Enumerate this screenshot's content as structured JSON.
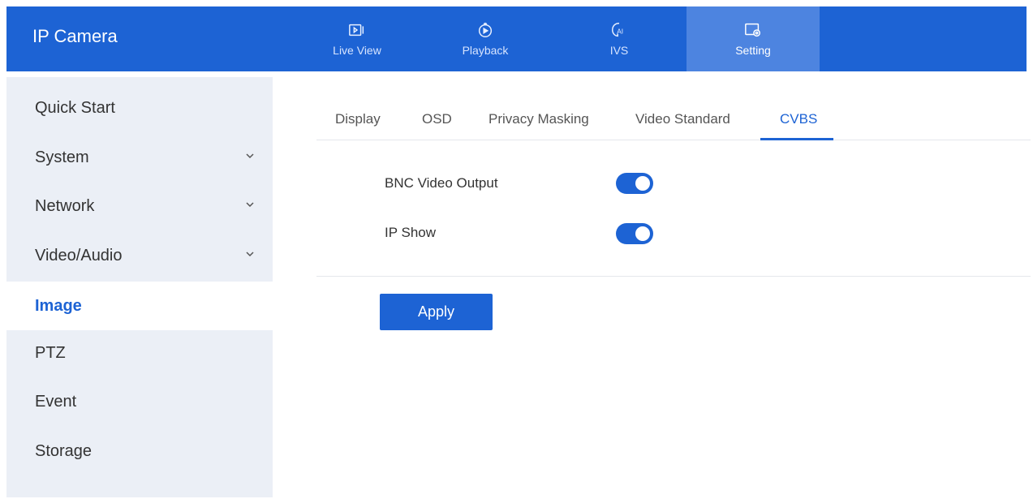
{
  "header": {
    "brand": "IP Camera",
    "nav": [
      {
        "label": "Live View",
        "icon": "live-view-icon"
      },
      {
        "label": "Playback",
        "icon": "playback-icon"
      },
      {
        "label": "IVS",
        "icon": "ai-ivs-icon"
      },
      {
        "label": "Setting",
        "icon": "setting-icon",
        "active": true
      }
    ]
  },
  "sidebar": {
    "items": [
      {
        "label": "Quick Start"
      },
      {
        "label": "System",
        "expandable": true
      },
      {
        "label": "Network",
        "expandable": true
      },
      {
        "label": "Video/Audio",
        "expandable": true
      },
      {
        "label": "Image",
        "active": true
      },
      {
        "label": "PTZ"
      },
      {
        "label": "Event"
      },
      {
        "label": "Storage"
      }
    ]
  },
  "tabs": [
    {
      "label": "Display"
    },
    {
      "label": "OSD"
    },
    {
      "label": "Privacy Masking"
    },
    {
      "label": "Video Standard"
    },
    {
      "label": "CVBS",
      "active": true
    }
  ],
  "settings": {
    "bnc_label": "BNC Video Output",
    "bnc_enabled": true,
    "ip_show_label": "IP Show",
    "ip_show_enabled": true
  },
  "apply_label": "Apply",
  "colors": {
    "accent": "#1d63d4",
    "sidebar_bg": "#ebeff6",
    "active_nav_bg": "#4d84e0"
  }
}
